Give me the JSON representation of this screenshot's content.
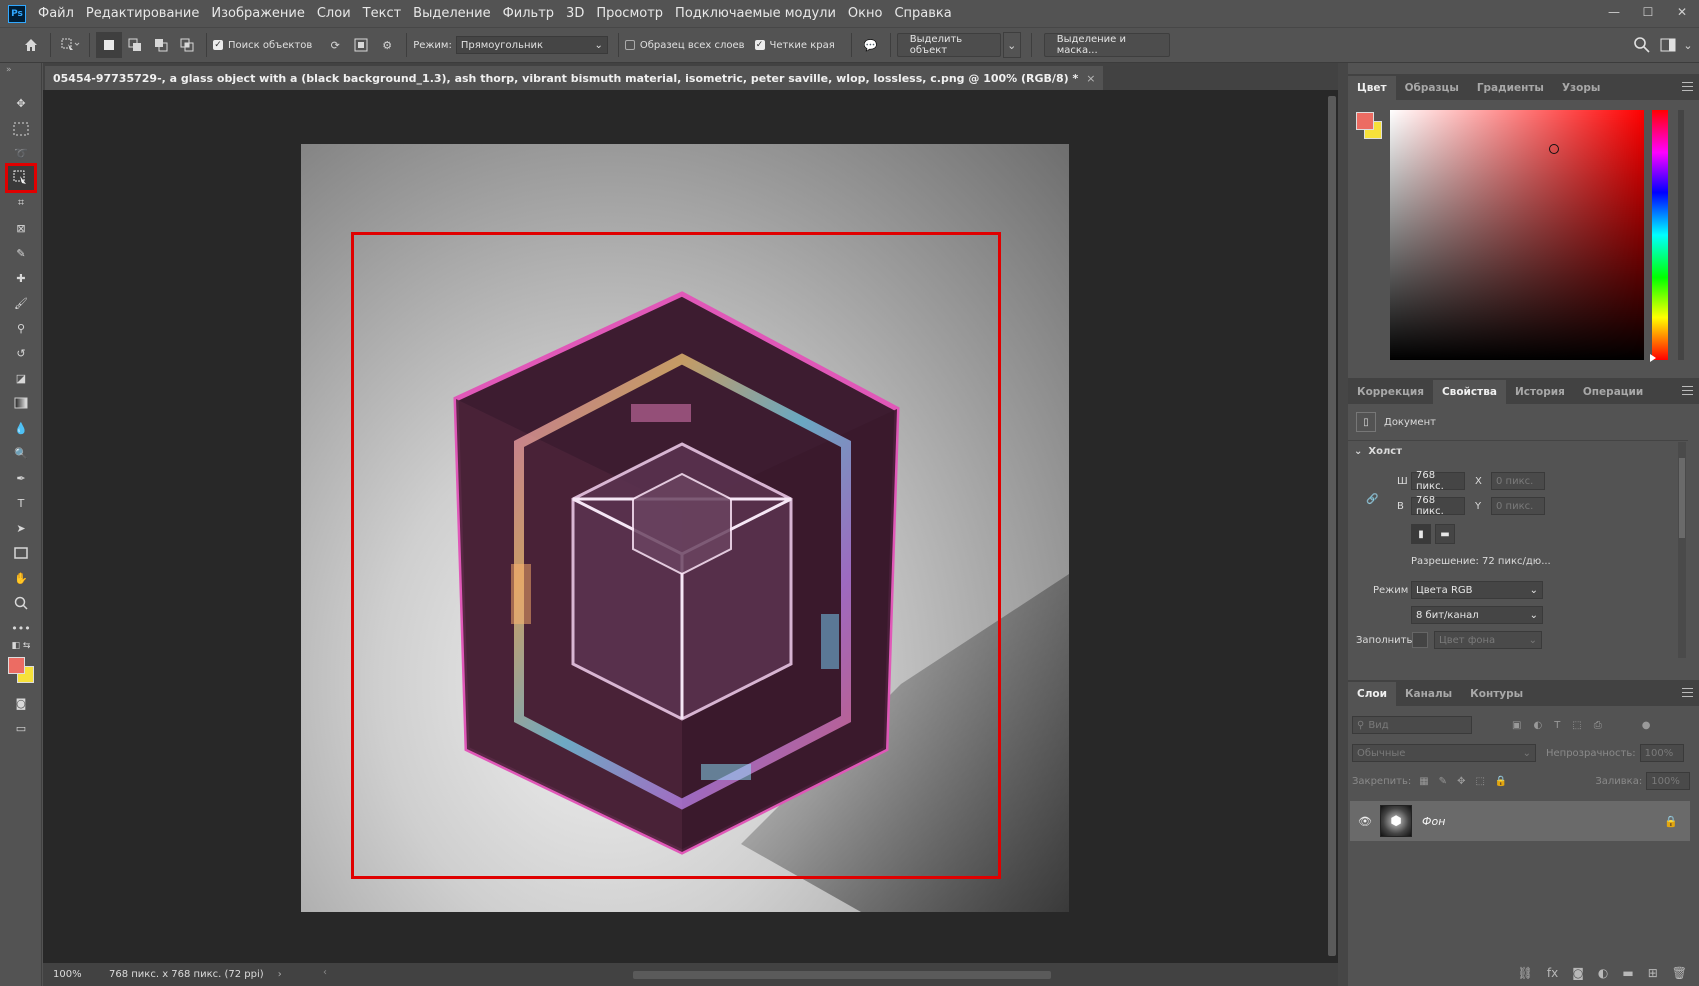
{
  "menubar": {
    "app_logo": "Ps",
    "items": [
      "Файл",
      "Редактирование",
      "Изображение",
      "Слои",
      "Текст",
      "Выделение",
      "Фильтр",
      "3D",
      "Просмотр",
      "Подключаемые модули",
      "Окно",
      "Справка"
    ]
  },
  "options": {
    "find_objects": "Поиск объектов",
    "mode_label": "Режим:",
    "mode_value": "Прямоугольник",
    "sample_all_layers": "Образец всех слоев",
    "sample_all_layers_checked": false,
    "sharp_edges": "Четкие края",
    "sharp_edges_checked": true,
    "select_object": "Выделить объект",
    "select_and_mask": "Выделение и маска..."
  },
  "document": {
    "tab_title": "05454-97735729-, a glass object with a (black background_1.3), ash thorp, vibrant bismuth material, isometric, peter saville, wlop, lossless, c.png @ 100% (RGB/8) *",
    "close": "×"
  },
  "status": {
    "zoom": "100%",
    "info": "768 пикс. x 768 пикс. (72 ppi)"
  },
  "color_panel": {
    "tabs": [
      "Цвет",
      "Образцы",
      "Градиенты",
      "Узоры"
    ],
    "active_tab": "Цвет",
    "foreground": "#ec6c63",
    "background": "#f7e13a"
  },
  "properties_panel": {
    "tabs": [
      "Коррекция",
      "Свойства",
      "История",
      "Операции"
    ],
    "active_tab": "Свойства",
    "doc_label": "Документ",
    "section": "Холст",
    "width_label": "Ш",
    "width_value": "768 пикс.",
    "height_label": "В",
    "height_value": "768 пикс.",
    "x_label": "X",
    "x_placeholder": "0 пикс.",
    "y_label": "Y",
    "y_placeholder": "0 пикс.",
    "resolution": "Разрешение: 72 пикс/дю...",
    "mode_label": "Режим",
    "mode_value": "Цвета RGB",
    "bit_depth": "8 бит/канал",
    "fill_label": "Заполнить",
    "fill_value": "Цвет фона"
  },
  "layers_panel": {
    "tabs": [
      "Слои",
      "Каналы",
      "Контуры"
    ],
    "active_tab": "Слои",
    "search_placeholder": "Вид",
    "blend_mode": "Обычные",
    "opacity_label": "Непрозрачность:",
    "opacity_value": "100%",
    "lock_label": "Закрепить:",
    "fill_label": "Заливка:",
    "fill_value": "100%",
    "layers": [
      {
        "name": "Фон",
        "visible": true,
        "locked": true
      }
    ]
  },
  "colors": {
    "accent_red": "#e00000",
    "selection_pink": "#e058b8"
  }
}
